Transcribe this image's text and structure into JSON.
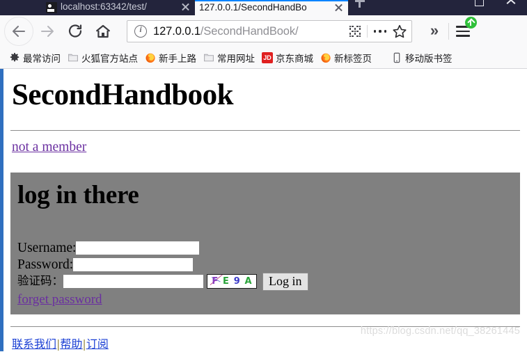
{
  "browser": {
    "tabs": [
      {
        "title": "localhost:63342/test/",
        "active": false,
        "favicon": "page-favicon"
      },
      {
        "title": "127.0.0.1/SecondHandBo",
        "active": true,
        "favicon": "none"
      }
    ],
    "new_tab_label": "+",
    "window_controls": {
      "maximize": "maximize",
      "close": "close"
    },
    "nav": {
      "back": "back",
      "forward": "forward",
      "reload": "reload",
      "home": "home",
      "overflow": "»"
    },
    "urlbar": {
      "info_icon": "info-icon",
      "domain": "127.0.0.1",
      "path": "/SecondHandBook/",
      "full_url": "127.0.0.1/SecondHandBook/",
      "qr_icon": "qr-code-icon",
      "page_actions_icon": "ellipsis-icon",
      "bookmark_icon": "star-icon"
    },
    "menu": {
      "icon": "hamburger-menu-icon",
      "badge": "update-available"
    },
    "bookmarks": [
      {
        "label": "最常访问",
        "icon": "gear-icon"
      },
      {
        "label": "火狐官方站点",
        "icon": "folder-icon"
      },
      {
        "label": "新手上路",
        "icon": "firefox-icon"
      },
      {
        "label": "常用网址",
        "icon": "folder-icon"
      },
      {
        "label": "京东商城",
        "icon": "jd-icon",
        "icon_text": "JD"
      },
      {
        "label": "新标签页",
        "icon": "firefox-icon"
      },
      {
        "label": "移动版书签",
        "icon": "phone-icon"
      }
    ]
  },
  "page": {
    "site_title": "SecondHandbook",
    "not_a_member_link": "not a member",
    "login": {
      "heading": "log in there",
      "username_label": "Username:",
      "username_value": "",
      "password_label": "Password:",
      "password_value": "",
      "captcha_label": "验证码：",
      "captcha_value": "",
      "captcha_image": {
        "chars": [
          {
            "ch": "F",
            "color": "#8a3fc0"
          },
          {
            "ch": "E",
            "color": "#2aa33a"
          },
          {
            "ch": "9",
            "color": "#3b3bc8"
          },
          {
            "ch": "A",
            "color": "#2aa33a"
          }
        ],
        "noise_line_color": "#c05090"
      },
      "submit_label": "Log in",
      "forget_password_link": "forget password"
    },
    "footer": {
      "links": [
        "联系我们",
        "帮助",
        "订阅"
      ],
      "separator": "|"
    },
    "watermark": "https://blog.csdn.net/qq_38261445"
  },
  "colors": {
    "chrome_dark": "#23243c",
    "tab_active_accent": "#0a84ff",
    "panel_gray": "#808080",
    "link_purple": "#6a2fa0",
    "link_blue": "#1a3fd4",
    "left_scrollbar": "#2f6fbf",
    "update_badge_green": "#30c03a"
  }
}
